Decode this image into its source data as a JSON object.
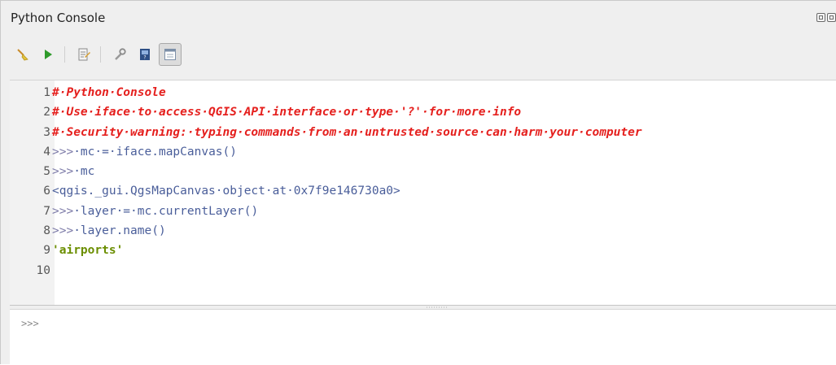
{
  "panel": {
    "title": "Python Console"
  },
  "toolbar": {
    "items": [
      {
        "icon": "clear-console-broom-icon"
      },
      {
        "icon": "run-command-icon"
      },
      {
        "icon": "show-editor-icon"
      },
      {
        "icon": "options-wrench-icon"
      },
      {
        "icon": "help-book-icon"
      },
      {
        "icon": "toggle-panel-icon"
      }
    ]
  },
  "editor": {
    "lines": [
      {
        "num": "1",
        "text": "#·Python·Console",
        "style": "comment"
      },
      {
        "num": "2",
        "text": "#·Use·iface·to·access·QGIS·API·interface·or·type·'?'·for·more·info",
        "style": "comment"
      },
      {
        "num": "3",
        "text": "#·Security·warning:·typing·commands·from·an·untrusted·source·can·harm·your·computer",
        "style": "comment"
      },
      {
        "num": "4",
        "prompt": ">>>",
        "text": "·mc·=·iface.mapCanvas()",
        "style": "plain"
      },
      {
        "num": "5",
        "prompt": ">>>",
        "text": "·mc",
        "style": "plain"
      },
      {
        "num": "6",
        "text": "<qgis._gui.QgsMapCanvas·object·at·0x7f9e146730a0>",
        "style": "plain"
      },
      {
        "num": "7",
        "prompt": ">>>",
        "text": "·layer·=·mc.currentLayer()",
        "style": "plain"
      },
      {
        "num": "8",
        "prompt": ">>>",
        "text": "·layer.name()",
        "style": "plain"
      },
      {
        "num": "9",
        "text": "'airports'",
        "style": "str"
      },
      {
        "num": "10",
        "text": "",
        "style": "plain"
      }
    ]
  },
  "input": {
    "prompt": ">>>"
  },
  "colors": {
    "comment": "#e5201e",
    "code": "#4a5e9a",
    "prompt": "#7d7ba8",
    "string": "#6b8e00"
  }
}
